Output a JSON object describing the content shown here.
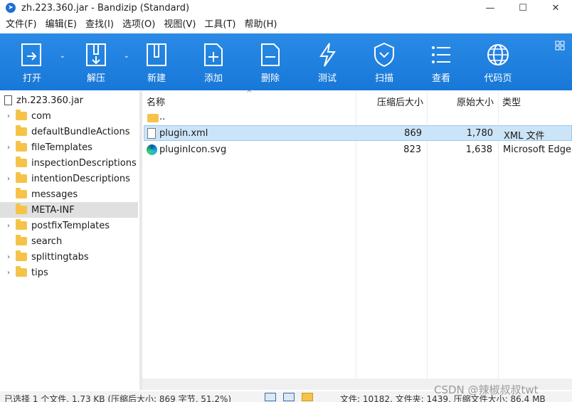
{
  "window": {
    "title": "zh.223.360.jar - Bandizip (Standard)"
  },
  "menu": [
    "文件(F)",
    "编辑(E)",
    "查找(I)",
    "选项(O)",
    "视图(V)",
    "工具(T)",
    "帮助(H)"
  ],
  "toolbar": {
    "open": "打开",
    "extract": "解压",
    "new": "新建",
    "add": "添加",
    "delete": "删除",
    "test": "测试",
    "scan": "扫描",
    "view": "查看",
    "codepage": "代码页"
  },
  "tree": {
    "root": "zh.223.360.jar",
    "items": [
      {
        "label": "com",
        "expandable": true
      },
      {
        "label": "defaultBundleActions",
        "expandable": false
      },
      {
        "label": "fileTemplates",
        "expandable": true
      },
      {
        "label": "inspectionDescriptions",
        "expandable": false
      },
      {
        "label": "intentionDescriptions",
        "expandable": true
      },
      {
        "label": "messages",
        "expandable": false
      },
      {
        "label": "META-INF",
        "expandable": false,
        "selected": true
      },
      {
        "label": "postfixTemplates",
        "expandable": true
      },
      {
        "label": "search",
        "expandable": false
      },
      {
        "label": "splittingtabs",
        "expandable": true
      },
      {
        "label": "tips",
        "expandable": true
      }
    ]
  },
  "list": {
    "columns": {
      "name": "名称",
      "compressed": "压缩后大小",
      "original": "原始大小",
      "type": "类型"
    },
    "parent": "..",
    "rows": [
      {
        "name": "plugin.xml",
        "compressed": "869",
        "original": "1,780",
        "type": "XML 文件",
        "icon": "xml-file-icon",
        "selected": true
      },
      {
        "name": "pluginIcon.svg",
        "compressed": "823",
        "original": "1,638",
        "type": "Microsoft Edge",
        "icon": "edge-icon",
        "selected": false
      }
    ]
  },
  "status": {
    "left": "已选择 1 个文件, 1.73 KB (压缩后大小: 869 字节, 51.2%)",
    "right": "文件: 10182, 文件夹: 1439, 压缩文件大小: 86.4 MB"
  },
  "watermark": "CSDN @辣椒叔叔twt",
  "colors": {
    "toolbar": "#1e7fdc",
    "selection": "#cce4f7",
    "folder": "#f5c34b"
  }
}
